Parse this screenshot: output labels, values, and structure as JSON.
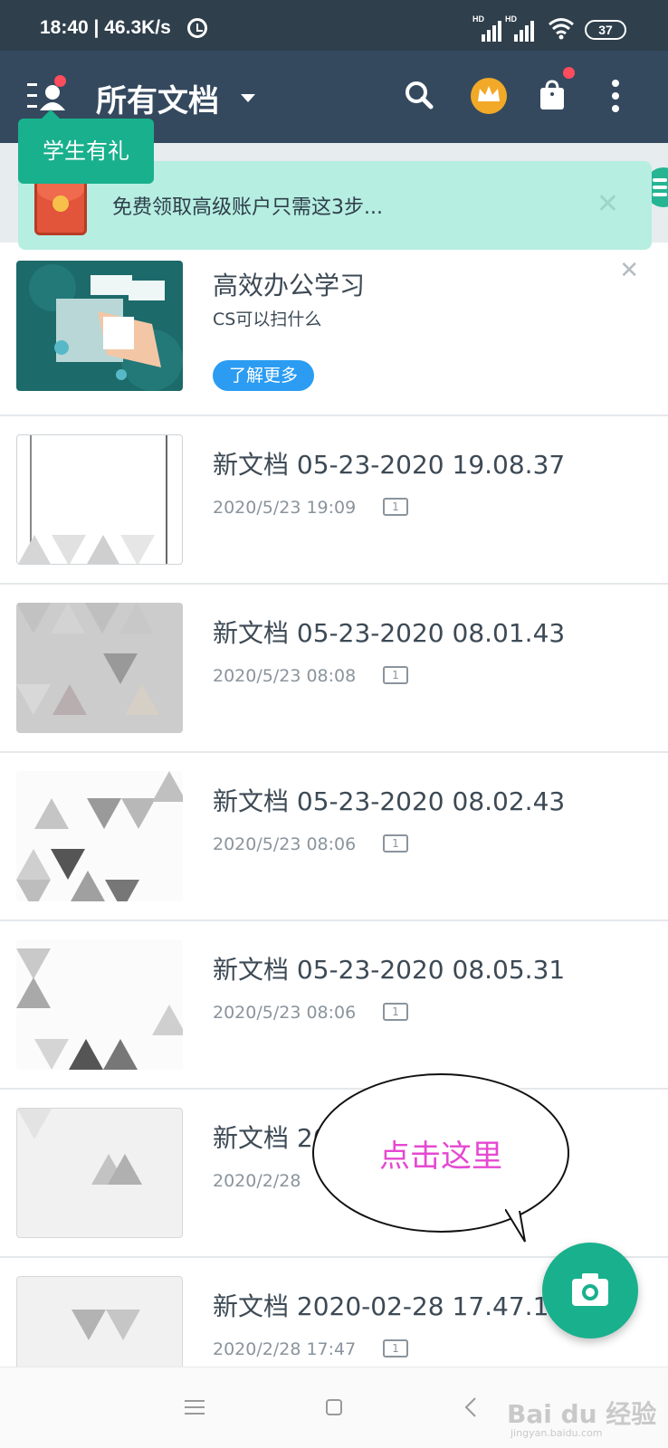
{
  "status_bar": {
    "time": "18:40 | 46.3K/s",
    "sim1": "HD",
    "sim2": "HD",
    "battery": "37"
  },
  "app_bar": {
    "title": "所有文档"
  },
  "tooltip": {
    "label": "学生有礼"
  },
  "banner": {
    "text": "免费领取高级账户只需这3步...",
    "close": "✕"
  },
  "ad_card": {
    "title": "高效办公学习",
    "subtitle": "CS可以扫什么",
    "button": "了解更多",
    "close": "✕"
  },
  "documents": [
    {
      "name": "新文档 05-23-2020 19.08.37",
      "date": "2020/5/23 19:09",
      "pages": "1"
    },
    {
      "name": "新文档 05-23-2020 08.01.43",
      "date": "2020/5/23 08:08",
      "pages": "1"
    },
    {
      "name": "新文档 05-23-2020 08.02.43",
      "date": "2020/5/23 08:06",
      "pages": "1"
    },
    {
      "name": "新文档 05-23-2020 08.05.31",
      "date": "2020/5/23 08:06",
      "pages": "1"
    },
    {
      "name": "新文档 20",
      "date": "2020/2/28",
      "pages": ""
    },
    {
      "name": "新文档 2020-02-28 17.47.10",
      "date": "2020/2/28 17:47",
      "pages": "1"
    }
  ],
  "callout": {
    "text": "点击这里"
  },
  "watermark": {
    "brand": "Bai du 经验",
    "url": "jingyan.baidu.com"
  },
  "colors": {
    "app_bar": "#34495e",
    "accent": "#19b08d",
    "banner": "#b6eee1",
    "link_button": "#2b9cf2",
    "callout_text": "#e548d1"
  }
}
